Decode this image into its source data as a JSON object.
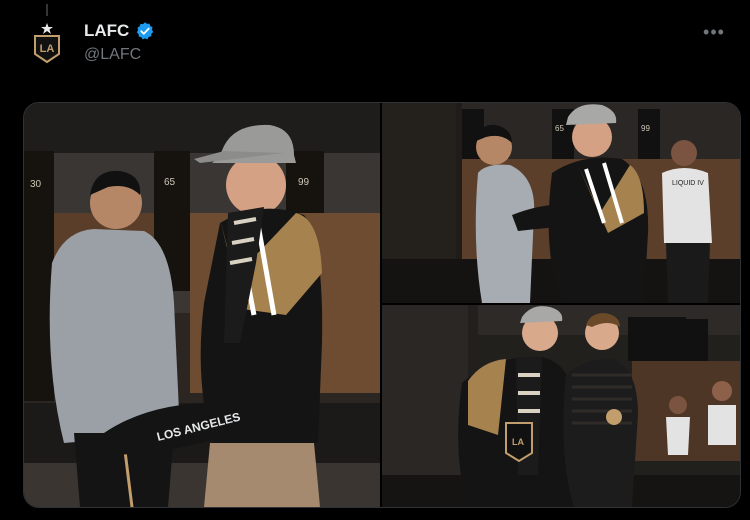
{
  "tweet": {
    "author": {
      "display_name": "LAFC",
      "handle": "@LAFC",
      "verified": true,
      "avatar_icon": "lafc-crest-icon"
    },
    "more_icon": "more-horizontal-icon",
    "media": [
      {
        "kind": "photo",
        "subject": "two-men-embracing-locker-room",
        "locker_numbers": [
          "30",
          "65",
          "99"
        ]
      },
      {
        "kind": "photo",
        "subject": "two-men-hugging-locker-room",
        "locker_numbers": [
          "65",
          "99"
        ]
      },
      {
        "kind": "photo",
        "subject": "two-men-posing-locker-room"
      }
    ]
  },
  "colors": {
    "background": "#000000",
    "text_primary": "#e7e9ea",
    "text_secondary": "#71767b",
    "verified_blue": "#1d9bf0",
    "lafc_gold": "#c39e6d"
  }
}
